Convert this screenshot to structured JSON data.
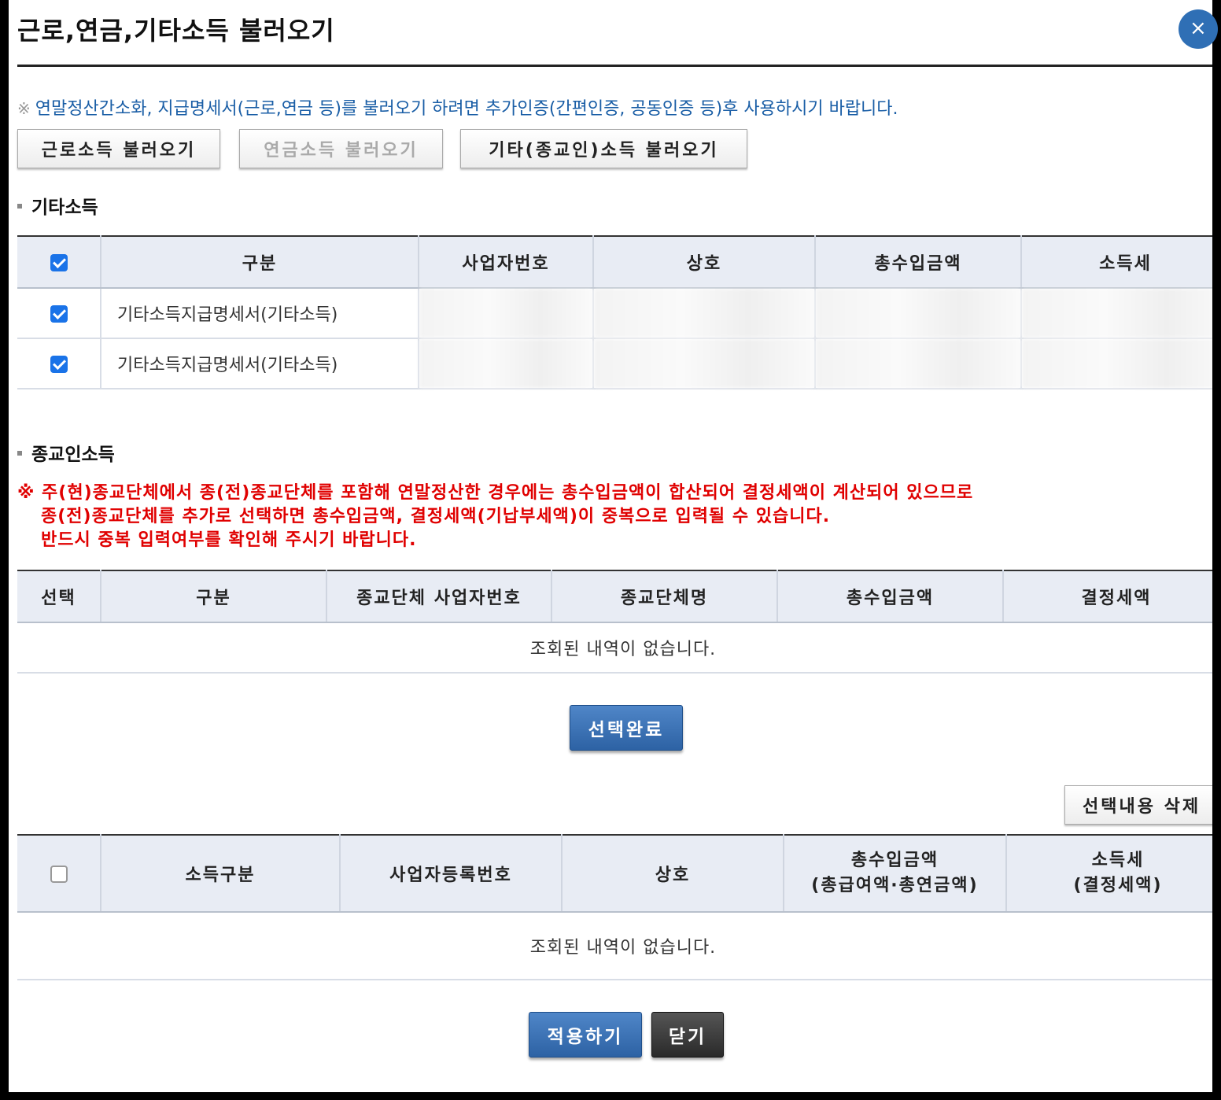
{
  "dialog": {
    "title": "근로,연금,기타소득 불러오기",
    "close_glyph": "×",
    "notice_mark": "※",
    "notice": "연말정산간소화, 지급명세서(근로,연금 등)를 불러오기 하려면 추가인증(간편인증, 공동인증 등)후 사용하시기 바랍니다."
  },
  "load_buttons": {
    "earned": "근로소득 불러오기",
    "pension": "연금소득 불러오기",
    "other": "기타(종교인)소득 불러오기"
  },
  "other_income": {
    "section_title": "기타소득",
    "headers": [
      "구분",
      "사업자번호",
      "상호",
      "총수입금액",
      "소득세"
    ],
    "rows": [
      {
        "type": "기타소득지급명세서(기타소득)",
        "checked": true
      },
      {
        "type": "기타소득지급명세서(기타소득)",
        "checked": true
      }
    ]
  },
  "religious_income": {
    "section_title": "종교인소득",
    "warning_line1": "※ 주(현)종교단체에서 종(전)종교단체를 포함해 연말정산한 경우에는 총수입금액이 합산되어 결정세액이 계산되어 있으므로",
    "warning_line2": "종(전)종교단체를 추가로 선택하면 총수입금액, 결정세액(기납부세액)이 중복으로 입력될 수 있습니다.",
    "warning_line3": "반드시 중복 입력여부를 확인해 주시기 바랍니다.",
    "headers": [
      "선택",
      "구분",
      "종교단체 사업자번호",
      "종교단체명",
      "총수입금액",
      "결정세액"
    ],
    "empty_text": "조회된 내역이 없습니다."
  },
  "select_done_label": "선택완료",
  "delete_selected_label": "선택내용 삭제",
  "summary_table": {
    "headers": [
      "소득구분",
      "사업자등록번호",
      "상호"
    ],
    "header_total_line1": "총수입금액",
    "header_total_line2": "(총급여액·총연금액)",
    "header_tax_line1": "소득세",
    "header_tax_line2": "(결정세액)",
    "empty_text": "조회된 내역이 없습니다."
  },
  "footer": {
    "apply_label": "적용하기",
    "close_label": "닫기"
  },
  "colors": {
    "accent_blue": "#2d62a4",
    "notice_blue": "#1a5ea6",
    "warning_red": "#e00000",
    "checkbox_blue": "#1a73e8"
  }
}
